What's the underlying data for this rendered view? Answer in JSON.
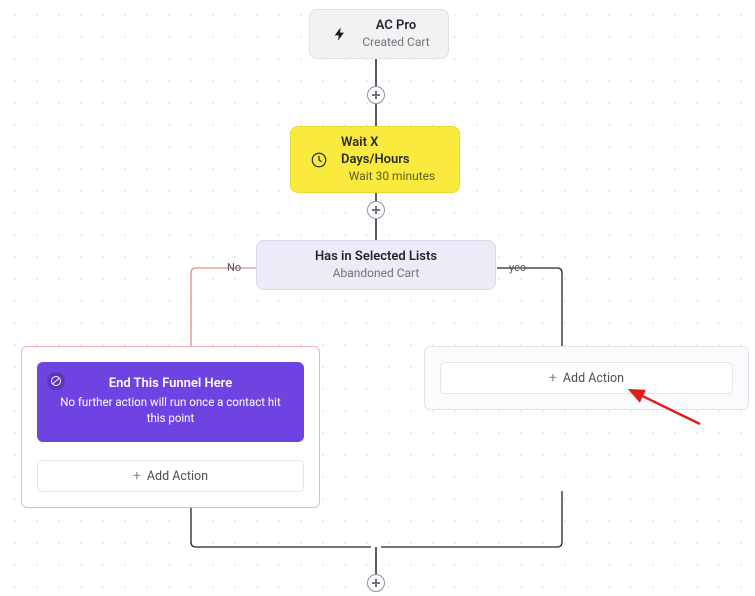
{
  "nodes": {
    "trigger": {
      "title": "AC Pro",
      "subtitle": "Created Cart"
    },
    "wait": {
      "title": "Wait X Days/Hours",
      "subtitle": "Wait 30 minutes"
    },
    "condition": {
      "title": "Has in Selected Lists",
      "subtitle": "Abandoned Cart"
    }
  },
  "branches": {
    "no_label": "No",
    "yes_label": "yes"
  },
  "end_card": {
    "title": "End This Funnel Here",
    "description": "No further action will run once a contact hit this point"
  },
  "buttons": {
    "add_action_left": "Add Action",
    "add_action_right": "Add Action"
  }
}
